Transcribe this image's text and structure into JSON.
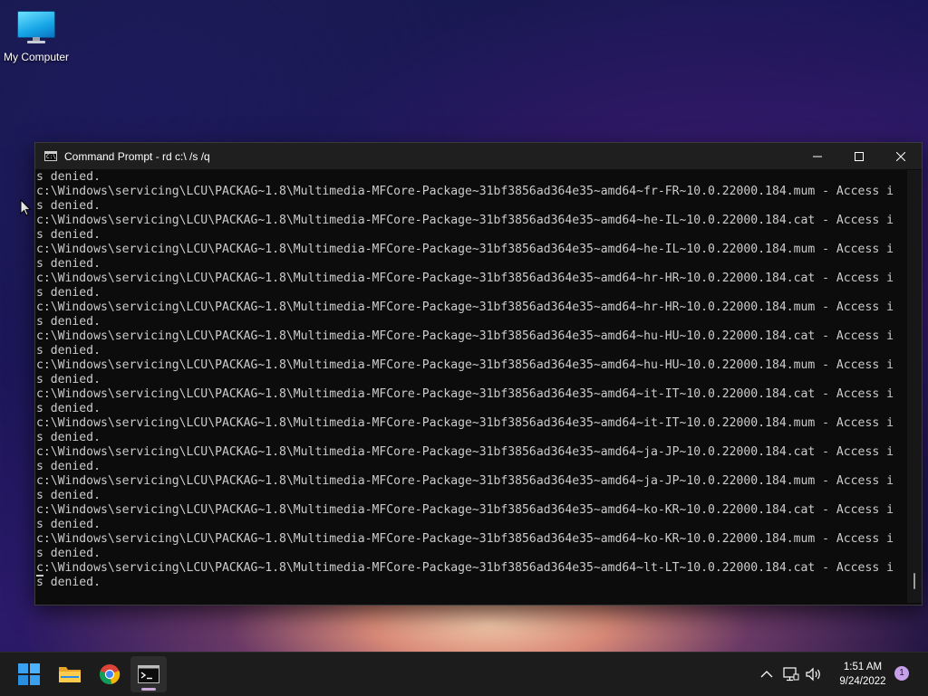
{
  "desktop": {
    "icons": [
      {
        "label": "My Computer",
        "icon": "computer-icon"
      }
    ]
  },
  "window": {
    "title": "Command Prompt - rd  c:\\ /s /q",
    "icon": "cmd-icon",
    "controls": {
      "minimize": "minimize-icon",
      "maximize": "maximize-icon",
      "close": "close-icon"
    },
    "console_lines": [
      "s denied.",
      "c:\\Windows\\servicing\\LCU\\PACKAG~1.8\\Multimedia-MFCore-Package~31bf3856ad364e35~amd64~fr-FR~10.0.22000.184.mum - Access i",
      "s denied.",
      "c:\\Windows\\servicing\\LCU\\PACKAG~1.8\\Multimedia-MFCore-Package~31bf3856ad364e35~amd64~he-IL~10.0.22000.184.cat - Access i",
      "s denied.",
      "c:\\Windows\\servicing\\LCU\\PACKAG~1.8\\Multimedia-MFCore-Package~31bf3856ad364e35~amd64~he-IL~10.0.22000.184.mum - Access i",
      "s denied.",
      "c:\\Windows\\servicing\\LCU\\PACKAG~1.8\\Multimedia-MFCore-Package~31bf3856ad364e35~amd64~hr-HR~10.0.22000.184.cat - Access i",
      "s denied.",
      "c:\\Windows\\servicing\\LCU\\PACKAG~1.8\\Multimedia-MFCore-Package~31bf3856ad364e35~amd64~hr-HR~10.0.22000.184.mum - Access i",
      "s denied.",
      "c:\\Windows\\servicing\\LCU\\PACKAG~1.8\\Multimedia-MFCore-Package~31bf3856ad364e35~amd64~hu-HU~10.0.22000.184.cat - Access i",
      "s denied.",
      "c:\\Windows\\servicing\\LCU\\PACKAG~1.8\\Multimedia-MFCore-Package~31bf3856ad364e35~amd64~hu-HU~10.0.22000.184.mum - Access i",
      "s denied.",
      "c:\\Windows\\servicing\\LCU\\PACKAG~1.8\\Multimedia-MFCore-Package~31bf3856ad364e35~amd64~it-IT~10.0.22000.184.cat - Access i",
      "s denied.",
      "c:\\Windows\\servicing\\LCU\\PACKAG~1.8\\Multimedia-MFCore-Package~31bf3856ad364e35~amd64~it-IT~10.0.22000.184.mum - Access i",
      "s denied.",
      "c:\\Windows\\servicing\\LCU\\PACKAG~1.8\\Multimedia-MFCore-Package~31bf3856ad364e35~amd64~ja-JP~10.0.22000.184.cat - Access i",
      "s denied.",
      "c:\\Windows\\servicing\\LCU\\PACKAG~1.8\\Multimedia-MFCore-Package~31bf3856ad364e35~amd64~ja-JP~10.0.22000.184.mum - Access i",
      "s denied.",
      "c:\\Windows\\servicing\\LCU\\PACKAG~1.8\\Multimedia-MFCore-Package~31bf3856ad364e35~amd64~ko-KR~10.0.22000.184.cat - Access i",
      "s denied.",
      "c:\\Windows\\servicing\\LCU\\PACKAG~1.8\\Multimedia-MFCore-Package~31bf3856ad364e35~amd64~ko-KR~10.0.22000.184.mum - Access i",
      "s denied.",
      "c:\\Windows\\servicing\\LCU\\PACKAG~1.8\\Multimedia-MFCore-Package~31bf3856ad364e35~amd64~lt-LT~10.0.22000.184.cat - Access i",
      "s denied."
    ]
  },
  "taskbar": {
    "pinned": [
      {
        "name": "start-button",
        "icon": "windows-logo-icon"
      },
      {
        "name": "file-explorer-button",
        "icon": "folder-icon"
      },
      {
        "name": "chrome-button",
        "icon": "chrome-icon"
      },
      {
        "name": "terminal-button",
        "icon": "cmd-icon",
        "active": true
      }
    ],
    "tray": {
      "icons": [
        "chevron-up-icon",
        "network-icon",
        "volume-icon"
      ],
      "time": "1:51 AM",
      "date": "9/24/2022",
      "notification_count": "1"
    }
  },
  "colors": {
    "console_bg": "#0c0c0c",
    "console_text": "#cccccc",
    "titlebar_bg": "#1f1f1f",
    "taskbar_bg": "#1c1c1c",
    "notif_badge": "#c6a0ea"
  }
}
